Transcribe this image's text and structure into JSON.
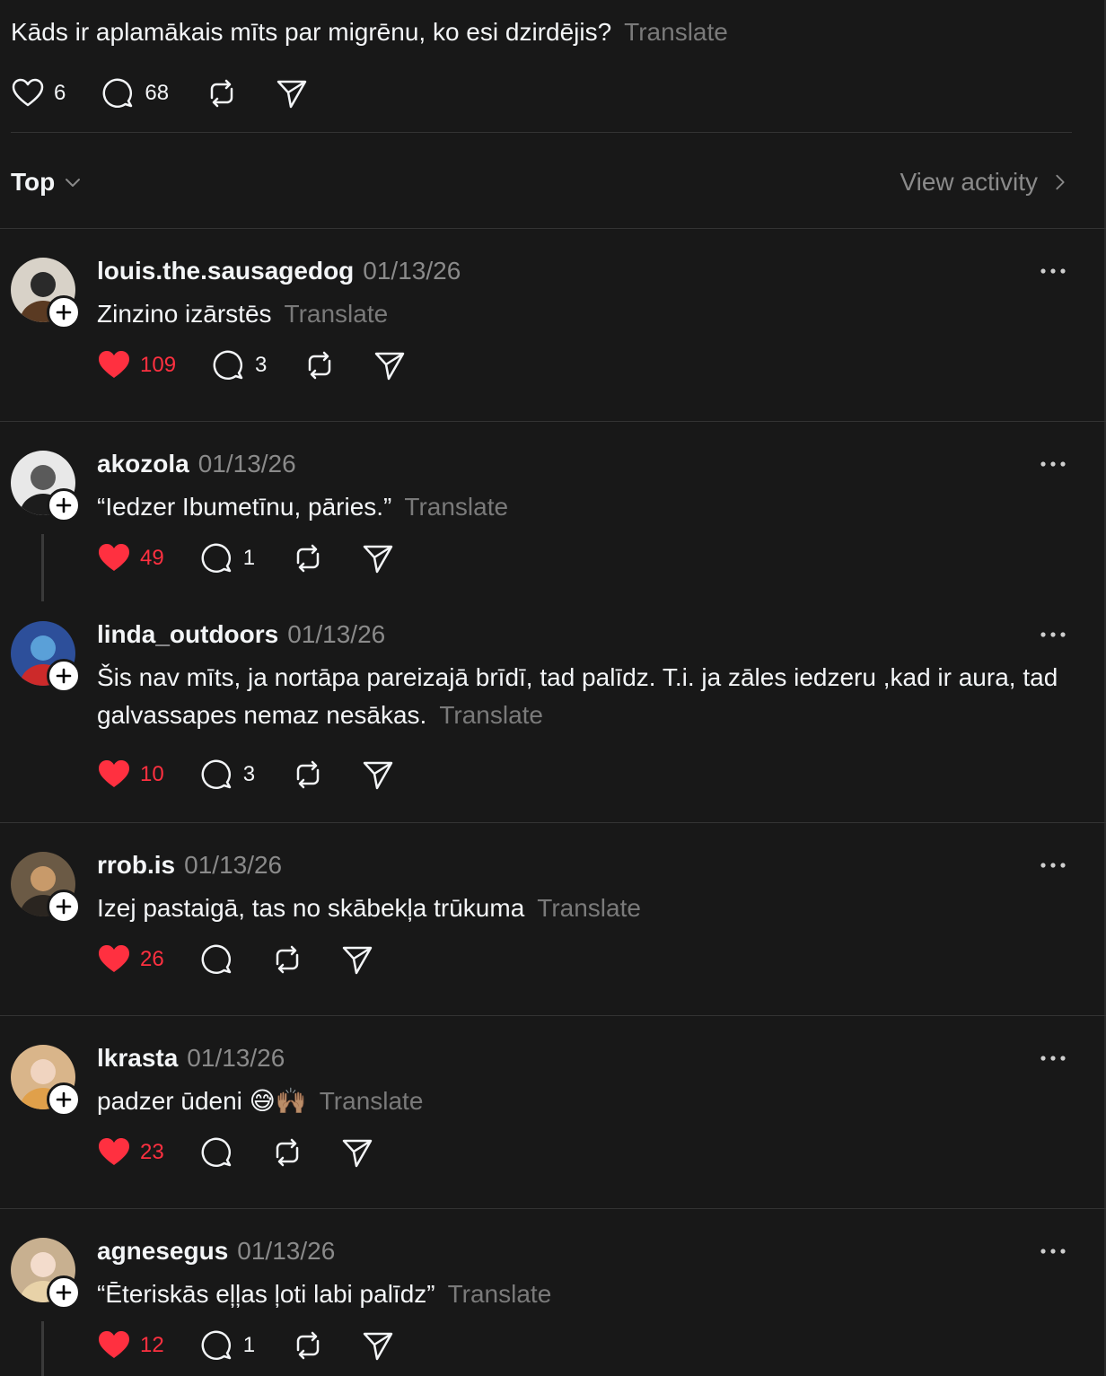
{
  "post": {
    "text": "Kāds ir aplamākais mīts par migrēnu, ko esi dzirdējis?",
    "translate": "Translate",
    "likes": "6",
    "replies": "68"
  },
  "sortbar": {
    "sort_label": "Top",
    "view_activity": "View activity"
  },
  "comments": [
    {
      "username": "louis.the.sausagedog",
      "date": "01/13/26",
      "text": "Zinzino izārstēs",
      "translate": "Translate",
      "likes": "109",
      "replies": "3"
    },
    {
      "username": "akozola",
      "date": "01/13/26",
      "text": "“Iedzer Ibumetīnu, pāries.”",
      "translate": "Translate",
      "likes": "49",
      "replies": "1"
    },
    {
      "username": "linda_outdoors",
      "date": "01/13/26",
      "text": "Šis nav mīts, ja nortāpa pareizajā brīdī, tad palīdz. T.i. ja zāles iedzeru ,kad ir aura, tad galvassapes nemaz nesākas.",
      "translate": "Translate",
      "likes": "10",
      "replies": "3"
    },
    {
      "username": "rrob.is",
      "date": "01/13/26",
      "text": "Izej pastaigā, tas no skābekļa trūkuma",
      "translate": "Translate",
      "likes": "26",
      "replies": ""
    },
    {
      "username": "lkrasta",
      "date": "01/13/26",
      "text": "padzer ūdeni 😅🙌🏽",
      "translate": "Translate",
      "likes": "23",
      "replies": ""
    },
    {
      "username": "agnesegus",
      "date": "01/13/26",
      "text": "“Ēteriskās eļļas ļoti labi palīdz”",
      "translate": "Translate",
      "likes": "12",
      "replies": "1"
    }
  ],
  "colors": {
    "background": "#181818",
    "like_red": "#ff3040",
    "muted": "#7a7a7a"
  }
}
